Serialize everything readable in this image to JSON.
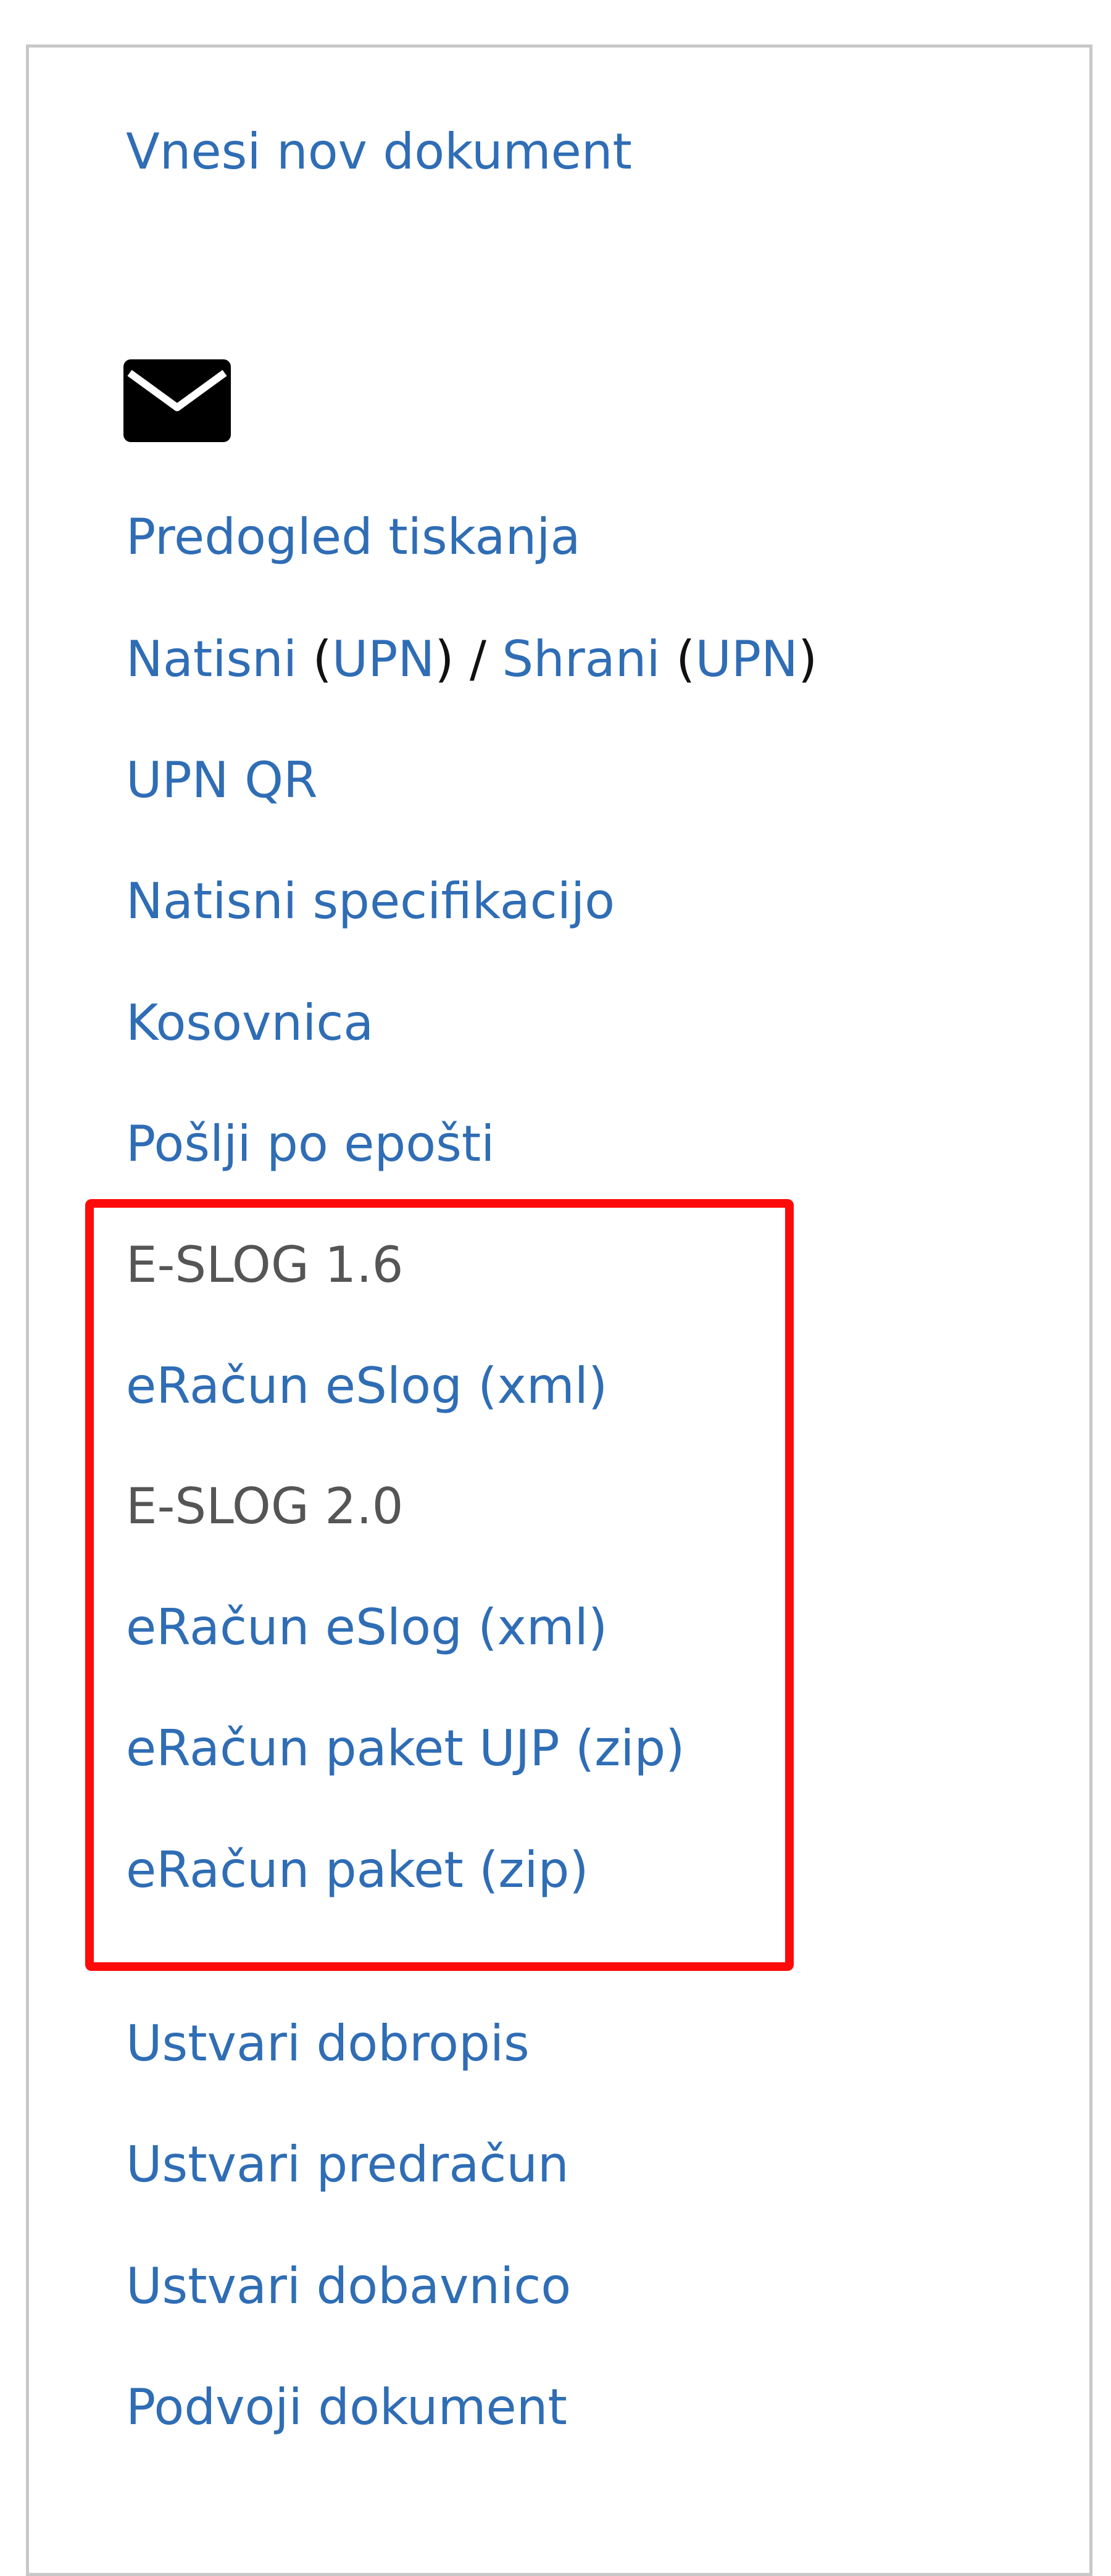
{
  "actions": {
    "new_document": "Vnesi nov dokument",
    "print_preview": "Predogled tiskanja",
    "print_upn": {
      "print_label": "Natisni",
      "print_paren": "UPN",
      "separator": " / ",
      "save_label": "Shrani",
      "save_paren": "UPN"
    },
    "upn_qr": "UPN QR",
    "print_spec": "Natisni specifikacijo",
    "kosovnica": "Kosovnica",
    "send_email": "Pošlji po epošti"
  },
  "eslog_group": {
    "v16_header": "E-SLOG 1.6",
    "v16_xml": "eRačun eSlog (xml)",
    "v20_header": "E-SLOG 2.0",
    "v20_xml": "eRačun eSlog (xml)",
    "v20_ujp_zip": "eRačun paket UJP (zip)",
    "v20_zip": "eRačun paket (zip)",
    "highlight_color": "#ff0a0a"
  },
  "more_actions": {
    "credit_note": "Ustvari dobropis",
    "proforma": "Ustvari predračun",
    "delivery_note": "Ustvari dobavnico",
    "duplicate": "Podvoji dokument"
  },
  "icons": {
    "mail": "envelope-icon"
  },
  "colors": {
    "link": "#2f6db5",
    "header_text": "#555555",
    "border": "#c8c8c8"
  }
}
